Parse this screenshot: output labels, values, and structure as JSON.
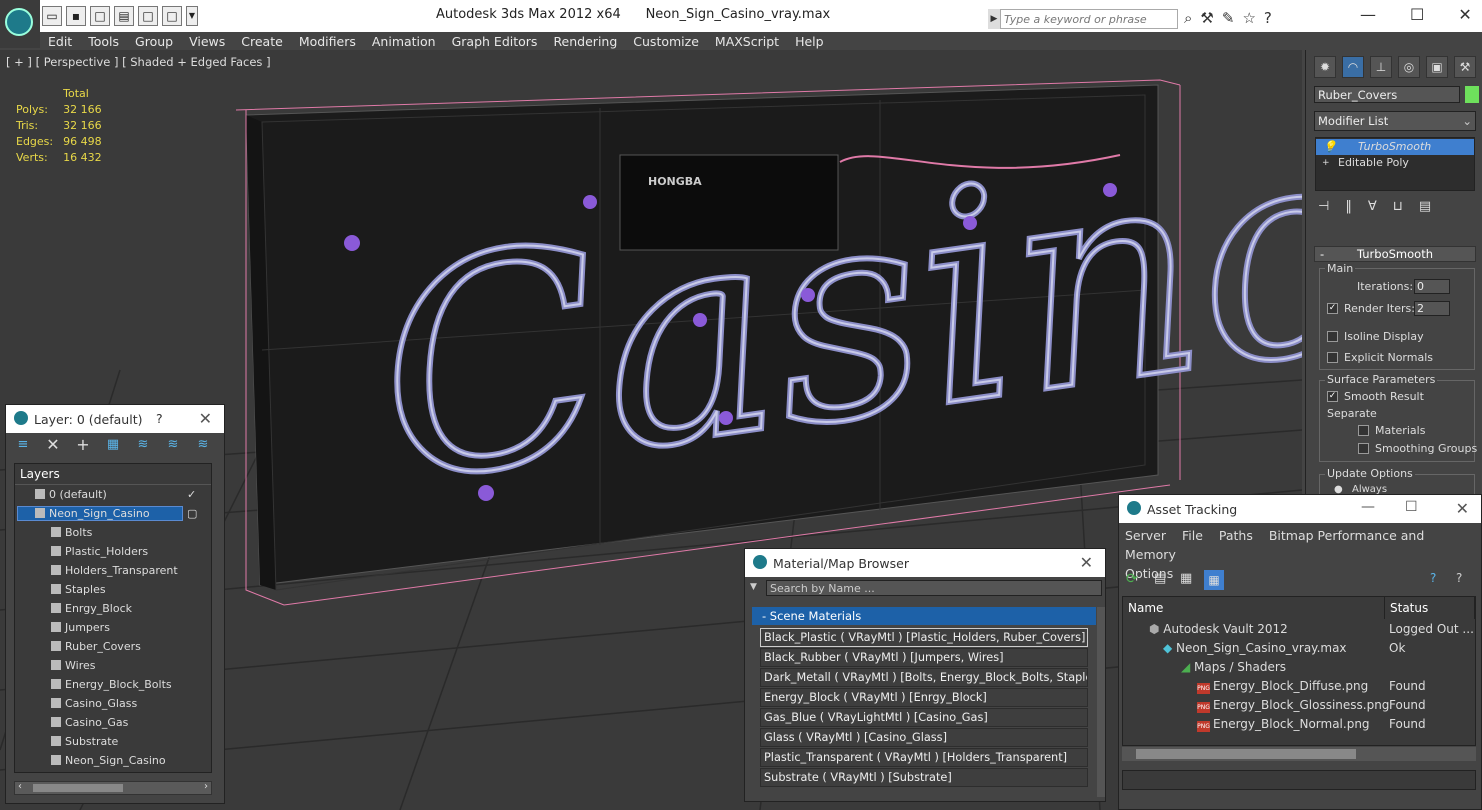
{
  "window": {
    "app_title": "Autodesk 3ds Max  2012 x64",
    "file_title": "Neon_Sign_Casino_vray.max",
    "search_placeholder": "Type a keyword or phrase"
  },
  "menu": [
    "Edit",
    "Tools",
    "Group",
    "Views",
    "Create",
    "Modifiers",
    "Animation",
    "Graph Editors",
    "Rendering",
    "Customize",
    "MAXScript",
    "Help"
  ],
  "viewport": {
    "label": "[ + ] [ Perspective ] [ Shaded + Edged Faces ]",
    "sign_text": "Casino",
    "box_brand": "HONGBA",
    "stats": {
      "header": "Total",
      "polys_label": "Polys:",
      "polys": "32 166",
      "tris_label": "Tris:",
      "tris": "32 166",
      "edges_label": "Edges:",
      "edges": "96 498",
      "verts_label": "Verts:",
      "verts": "16 432"
    }
  },
  "command_panel": {
    "object_name": "Ruber_Covers",
    "object_color": "#6ee05c",
    "modifier_list": "Modifier List",
    "stack": [
      "TurboSmooth",
      "Editable Poly"
    ],
    "rollout_title": "TurboSmooth",
    "main_group": "Main",
    "iterations_label": "Iterations:",
    "iterations": "0",
    "render_iters_label": "Render Iters:",
    "render_iters": "2",
    "isoline_label": "Isoline Display",
    "explicit_normals_label": "Explicit Normals",
    "surface_group": "Surface Parameters",
    "smooth_result_label": "Smooth Result",
    "separate_label": "Separate",
    "materials_label": "Materials",
    "smoothing_groups_label": "Smoothing Groups",
    "update_group": "Update Options",
    "always_label": "Always"
  },
  "layer_panel": {
    "title": "Layer: 0 (default)",
    "help": "?",
    "column": "Layers",
    "layers": [
      "0 (default)",
      "Neon_Sign_Casino"
    ],
    "objects": [
      "Bolts",
      "Plastic_Holders",
      "Holders_Transparent",
      "Staples",
      "Enrgy_Block",
      "Jumpers",
      "Ruber_Covers",
      "Wires",
      "Energy_Block_Bolts",
      "Casino_Glass",
      "Casino_Gas",
      "Substrate",
      "Neon_Sign_Casino"
    ]
  },
  "material_browser": {
    "title": "Material/Map Browser",
    "search_placeholder": "Search by Name ...",
    "section": "- Scene Materials",
    "materials": [
      "Black_Plastic  ( VRayMtl ) [Plastic_Holders, Ruber_Covers]",
      "Black_Rubber  ( VRayMtl ) [Jumpers, Wires]",
      "Dark_Metall  ( VRayMtl ) [Bolts, Energy_Block_Bolts, Staples]",
      "Energy_Block  ( VRayMtl ) [Enrgy_Block]",
      "Gas_Blue  ( VRayLightMtl ) [Casino_Gas]",
      "Glass  ( VRayMtl ) [Casino_Glass]",
      "Plastic_Transparent  ( VRayMtl ) [Holders_Transparent]",
      "Substrate  ( VRayMtl ) [Substrate]"
    ]
  },
  "asset_tracking": {
    "title": "Asset Tracking",
    "menu": [
      "Server",
      "File",
      "Paths",
      "Bitmap Performance and Memory"
    ],
    "menu2": "Options",
    "col_name": "Name",
    "col_status": "Status",
    "rows": [
      {
        "name": "Autodesk Vault 2012",
        "status": "Logged Out ..."
      },
      {
        "name": "Neon_Sign_Casino_vray.max",
        "status": "Ok"
      },
      {
        "name": "Maps / Shaders",
        "status": ""
      },
      {
        "name": "Energy_Block_Diffuse.png",
        "status": "Found"
      },
      {
        "name": "Energy_Block_Glossiness.png",
        "status": "Found"
      },
      {
        "name": "Energy_Block_Normal.png",
        "status": "Found"
      }
    ]
  }
}
